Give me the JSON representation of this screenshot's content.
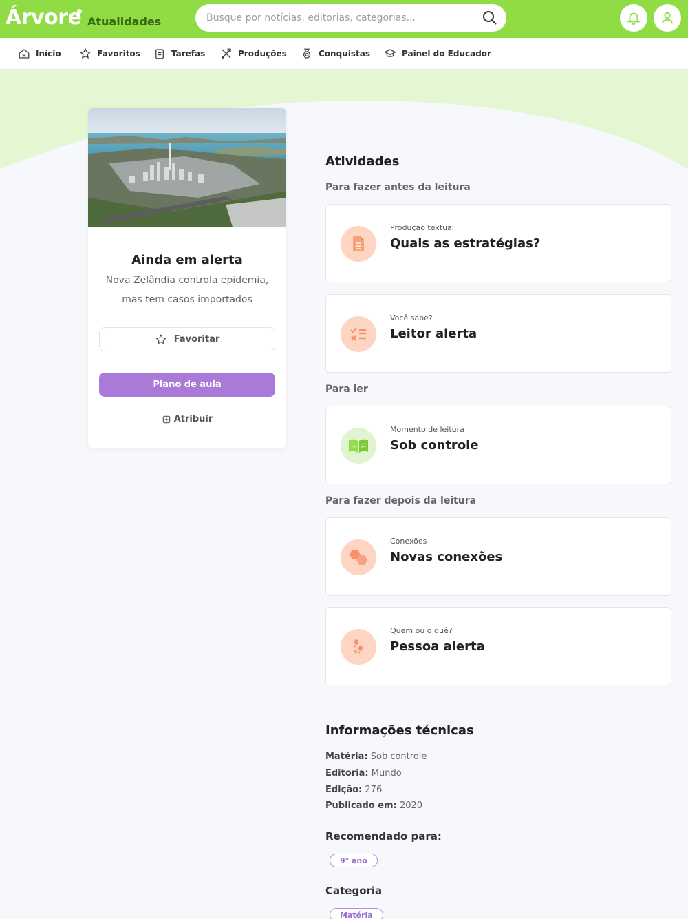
{
  "header": {
    "logo": "Árvore",
    "section": "Atualidades",
    "search_placeholder": "Busque por notícias, editorias, categorias..."
  },
  "nav": {
    "items": [
      {
        "label": "Início",
        "icon": "home-icon"
      },
      {
        "label": "Favoritos",
        "icon": "star-icon"
      },
      {
        "label": "Tarefas",
        "icon": "clipboard-icon"
      },
      {
        "label": "Produções",
        "icon": "tools-icon"
      },
      {
        "label": "Conquistas",
        "icon": "medal-icon"
      },
      {
        "label": "Painel do Educador",
        "icon": "graduation-cap-icon"
      }
    ]
  },
  "article": {
    "title": "Ainda em alerta",
    "subtitle": "Nova Zelândia controla epidemia, mas tem casos importados",
    "favorite_label": "Favoritar",
    "plan_label": "Plano de aula",
    "assign_label": "Atribuir"
  },
  "activities": {
    "title": "Atividades",
    "groups": [
      {
        "label": "Para fazer antes da leitura",
        "items": [
          {
            "kind": "Produção textual",
            "title": "Quais as estratégias?",
            "icon": "document-icon"
          },
          {
            "kind": "Você sabe?",
            "title": "Leitor alerta",
            "icon": "checklist-icon"
          }
        ]
      },
      {
        "label": "Para ler",
        "items": [
          {
            "kind": "Momento de leitura",
            "title": "Sob controle",
            "icon": "book-icon"
          }
        ]
      },
      {
        "label": "Para fazer depois da leitura",
        "items": [
          {
            "kind": "Conexões",
            "title": "Novas conexões",
            "icon": "hexagons-icon"
          },
          {
            "kind": "Quem ou o quê?",
            "title": "Pessoa alerta",
            "icon": "footprints-icon"
          }
        ]
      }
    ]
  },
  "tech_info": {
    "title": "Informações técnicas",
    "lines": [
      {
        "label": "Matéria:",
        "value": "Sob controle"
      },
      {
        "label": "Editoria:",
        "value": "Mundo"
      },
      {
        "label": "Edição:",
        "value": "276"
      },
      {
        "label": "Publicado em:",
        "value": "2020"
      }
    ],
    "recommended_label": "Recomendado para:",
    "recommended_tag": "9° ano",
    "category_label": "Categoria",
    "category_tag": "Matéria"
  },
  "colors": {
    "brand_green": "#8fdc45",
    "accent_purple": "#a97ad7",
    "icon_orange_bg": "#fdd5c2",
    "icon_green_bg": "#e0f4cf"
  }
}
